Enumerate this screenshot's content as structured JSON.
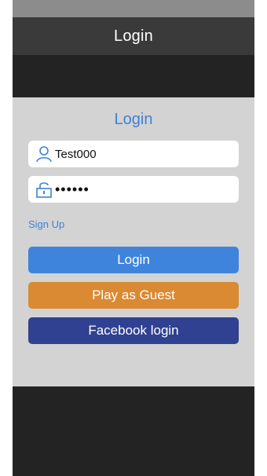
{
  "nav": {
    "title": "Login"
  },
  "panel": {
    "title": "Login"
  },
  "username": {
    "icon": "user-icon",
    "value": "Test000"
  },
  "password": {
    "icon": "lock-icon",
    "value": "••••••"
  },
  "links": {
    "sign_up": "Sign Up"
  },
  "buttons": {
    "login": "Login",
    "guest": "Play as Guest",
    "facebook": "Facebook login"
  },
  "colors": {
    "accent_blue": "#3f82d6",
    "login_button": "#3f84dc",
    "guest_button": "#d98a32",
    "facebook_button": "#2f4190",
    "panel_background": "#d3d3d3",
    "screen_background": "#232323"
  }
}
